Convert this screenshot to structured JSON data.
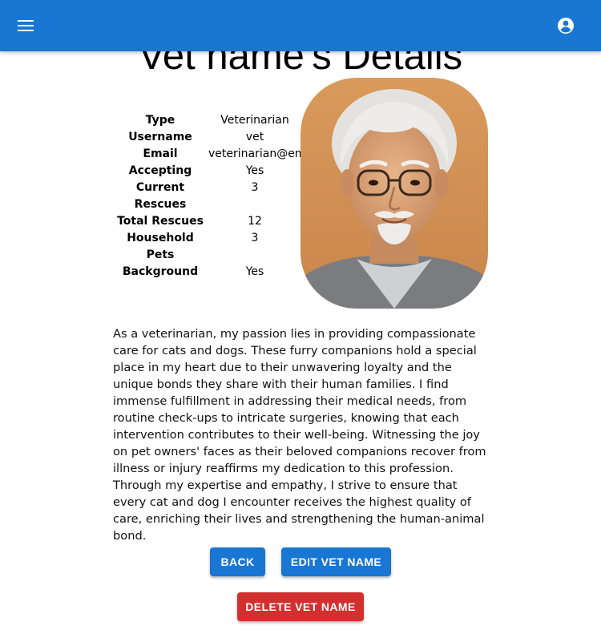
{
  "appbar": {
    "menu_icon": "hamburger-menu-icon",
    "account_icon": "account-circle-icon",
    "color": "#1976d2"
  },
  "page": {
    "title": "Vet name's Details"
  },
  "details": [
    {
      "label": "Type",
      "value": "Veterinarian"
    },
    {
      "label": "Username",
      "value": "vet"
    },
    {
      "label": "Email",
      "value": "veterinarian@em"
    },
    {
      "label": "Accepting",
      "value": "Yes"
    },
    {
      "label": "Current Rescues",
      "value": "3"
    },
    {
      "label": "Total Rescues",
      "value": "12"
    },
    {
      "label": "Household Pets",
      "value": "3"
    },
    {
      "label": "Background Check",
      "value": "Yes"
    }
  ],
  "bio": "As a veterinarian, my passion lies in providing compassionate care for cats and dogs. These furry companions hold a special place in my heart due to their unwavering loyalty and the unique bonds they share with their human families. I find immense fulfillment in addressing their medical needs, from routine check-ups to intricate surgeries, knowing that each intervention contributes to their well-being. Witnessing the joy on pet owners' faces as their beloved companions recover from illness or injury reaffirms my dedication to this profession. Through my expertise and empathy, I strive to ensure that every cat and dog I encounter receives the highest quality of care, enriching their lives and strengthening the human-animal bond.",
  "actions": {
    "back": "BACK",
    "edit": "EDIT VET NAME",
    "delete": "DELETE VET NAME"
  },
  "colors": {
    "primary": "#1976d2",
    "danger": "#d32f2f"
  }
}
